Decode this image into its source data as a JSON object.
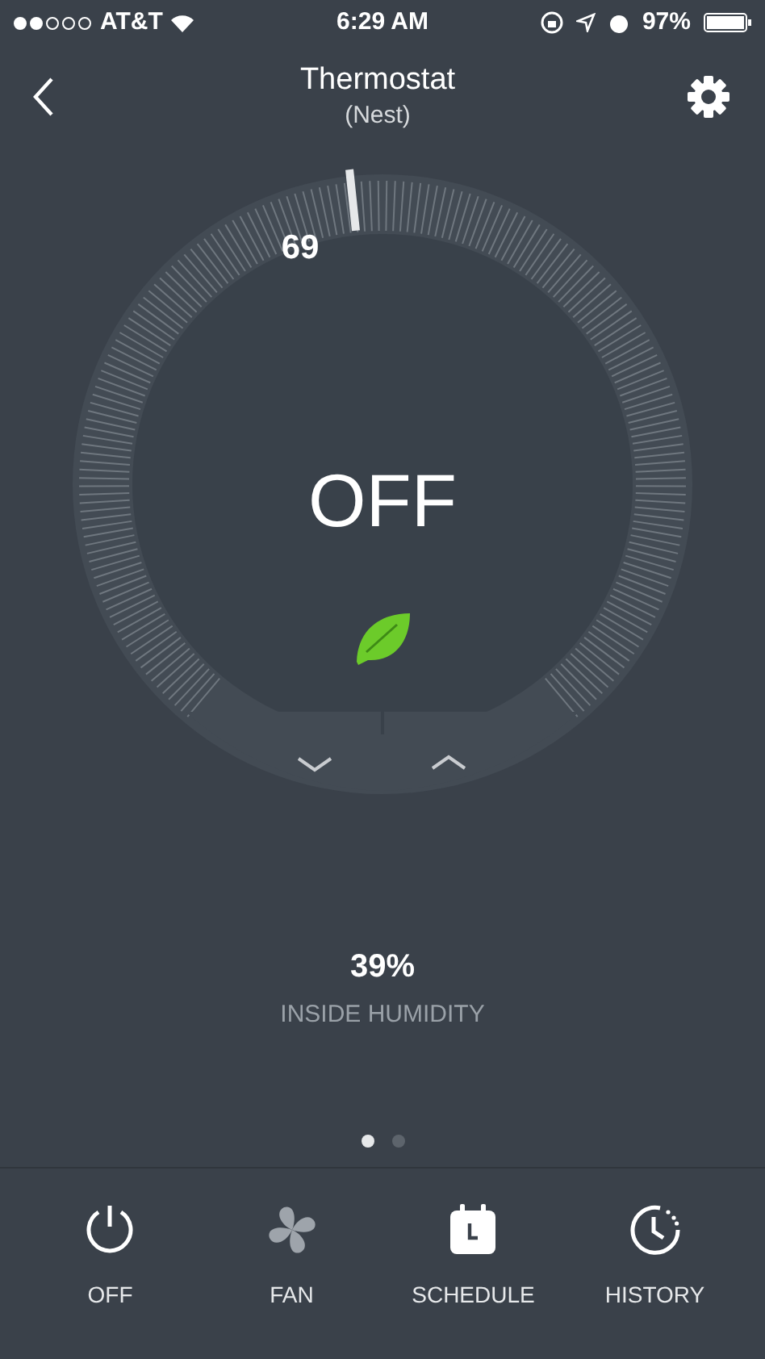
{
  "status_bar": {
    "carrier": "AT&T",
    "time": "6:29 AM",
    "battery": "97%"
  },
  "header": {
    "title": "Thermostat",
    "subtitle": "(Nest)"
  },
  "dial": {
    "setpoint": "69",
    "mode": "OFF",
    "eco": true
  },
  "humidity": {
    "value": "39%",
    "label": "INSIDE HUMIDITY"
  },
  "pages": [
    {
      "selected": true
    },
    {
      "selected": false
    }
  ],
  "tab_bar": [
    {
      "kind": "power",
      "label": "OFF",
      "disabled": false
    },
    {
      "kind": "fan",
      "label": "FAN",
      "disabled": true
    },
    {
      "kind": "schedule",
      "label": "SCHEDULE",
      "disabled": false
    },
    {
      "kind": "history",
      "label": "HISTORY",
      "disabled": false
    }
  ]
}
